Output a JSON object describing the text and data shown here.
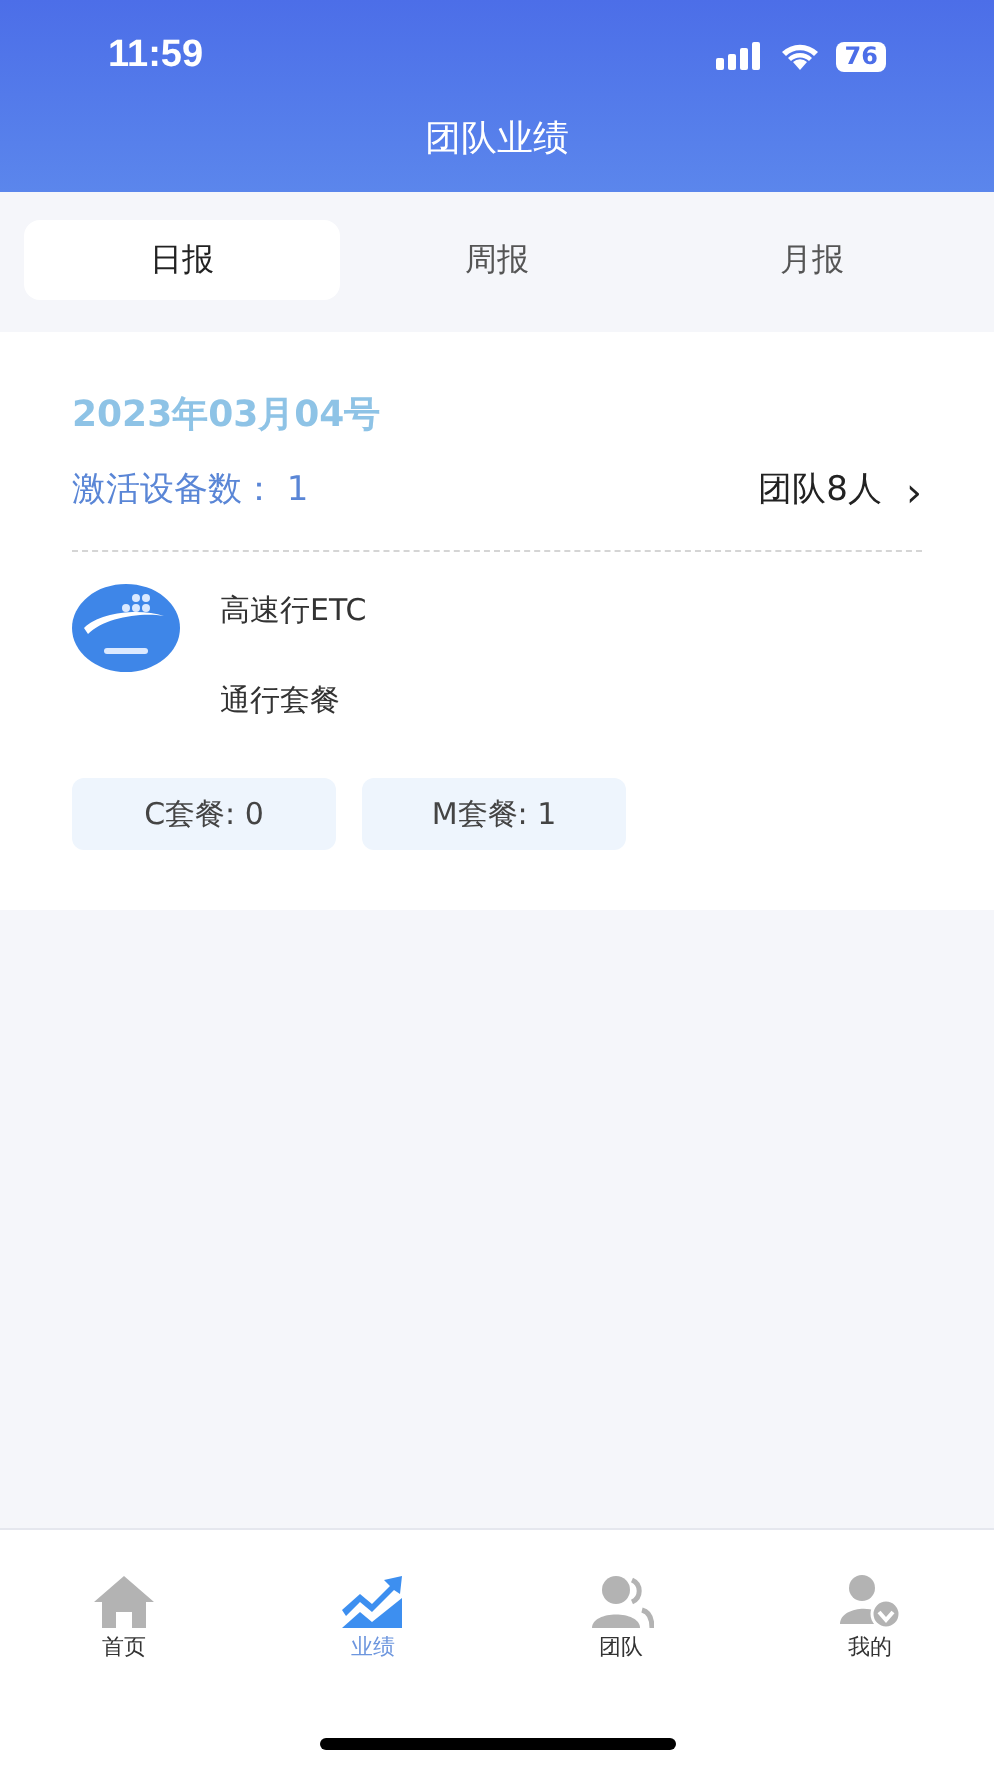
{
  "status_bar": {
    "time": "11:59",
    "battery": "76"
  },
  "header": {
    "title": "团队业绩"
  },
  "tabs": [
    {
      "label": "日报",
      "selected": true
    },
    {
      "label": "周报",
      "selected": false
    },
    {
      "label": "月报",
      "selected": false
    }
  ],
  "report": {
    "date": "2023年03月04号",
    "activated_label": "激活设备数：",
    "activated_value": "1",
    "team_link": "团队8人",
    "team_chevron": "›",
    "product": {
      "name": "高速行ETC",
      "plan": "通行套餐"
    },
    "packages": [
      "C套餐: 0",
      "M套餐: 1"
    ]
  },
  "bottom_nav": [
    {
      "label": "首页",
      "kind": "home",
      "selected": false
    },
    {
      "label": "业绩",
      "kind": "chart",
      "selected": true
    },
    {
      "label": "团队",
      "kind": "team",
      "selected": false
    },
    {
      "label": "我的",
      "kind": "me",
      "selected": false
    }
  ]
}
